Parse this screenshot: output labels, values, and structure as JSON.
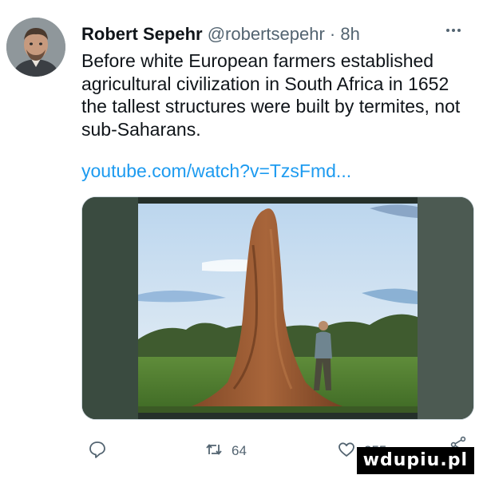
{
  "tweet": {
    "author_name": "Robert Sepehr",
    "handle": "@robertsepehr",
    "separator": "·",
    "time": "8h",
    "text": "Before white European farmers established agricultural civilization in South Africa in 1652 the tallest structures were built by termites, not sub-Saharans.",
    "link_text": "youtube.com/watch?v=TzsFmd..."
  },
  "actions": {
    "retweet_count": "64",
    "like_count": "255"
  },
  "watermark": "wdupiu.pl",
  "colors": {
    "link": "#1d9bf0",
    "secondary_text": "#536471",
    "border": "#cfd9de"
  },
  "icons": [
    "avatar",
    "more-icon",
    "reply-icon",
    "retweet-icon",
    "like-icon",
    "share-icon"
  ]
}
